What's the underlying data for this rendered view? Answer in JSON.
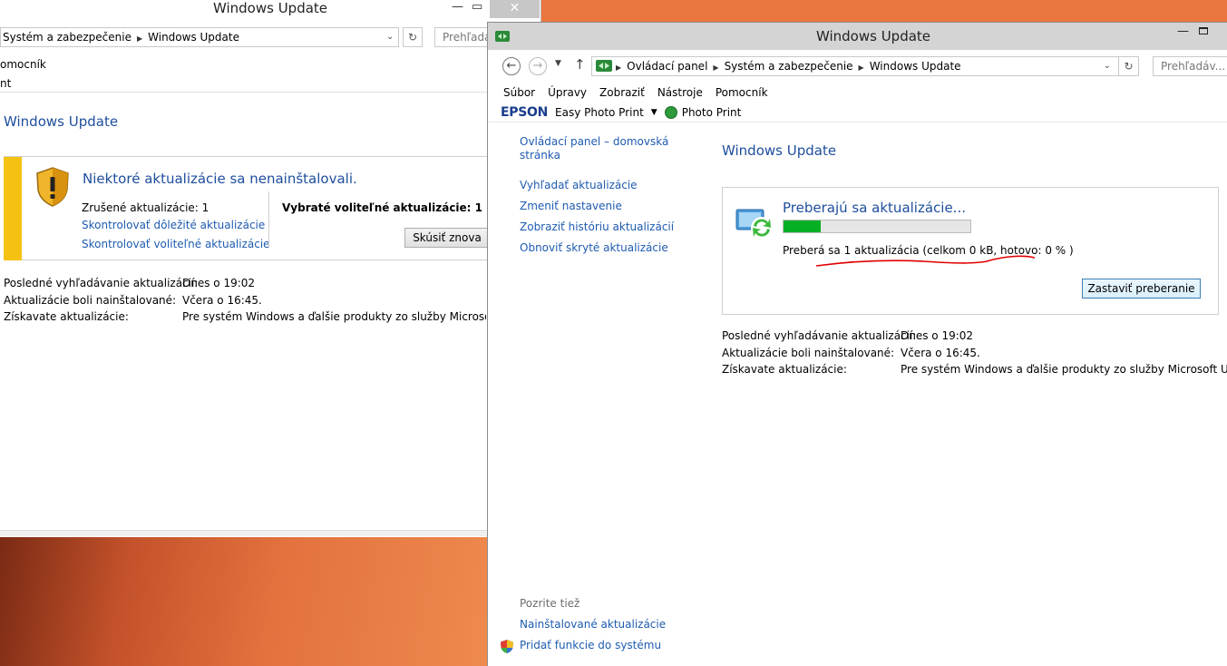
{
  "back_window": {
    "title": "Windows Update",
    "close_glyph": "✕",
    "address": {
      "crumb1": "Systém a zabezpečenie",
      "crumb2": "Windows Update"
    },
    "search_placeholder": "Prehľadá",
    "menu_line1": "omocník",
    "menu_line2": "nt",
    "heading": "Windows Update",
    "panel": {
      "title": "Niektoré aktualizácie sa nenainštalovali.",
      "cancelled": "Zrušené aktualizácie: 1",
      "link_important": "Skontrolovať dôležité aktualizácie",
      "link_optional": "Skontrolovať voliteľné aktualizácie",
      "selected_optional": "Vybraté voliteľné aktualizácie: 1",
      "retry_button": "Skúsiť znova"
    },
    "info": [
      {
        "key": "Posledné vyhľadávanie aktualizácií:",
        "value": "Dnes o 19:02"
      },
      {
        "key": "Aktualizácie boli nainštalované:",
        "value": "Včera o 16:45."
      },
      {
        "key": "Získavate aktualizácie:",
        "value": "Pre systém Windows a ďalšie produkty zo služby Microsoft Upda"
      }
    ]
  },
  "front_window": {
    "title": "Windows Update",
    "address": {
      "crumb1": "Ovládací panel",
      "crumb2": "Systém a zabezpečenie",
      "crumb3": "Windows Update"
    },
    "search_placeholder": "Prehľadáv...",
    "menu": [
      "Súbor",
      "Úpravy",
      "Zobraziť",
      "Nástroje",
      "Pomocník"
    ],
    "epson": {
      "brand": "EPSON",
      "easy_photo_print": "Easy Photo Print",
      "photo_print": "Photo Print"
    },
    "sidebar": {
      "home": "Ovládací panel – domovská",
      "home2": "stránka",
      "links": [
        "Vyhľadať aktualizácie",
        "Zmeniť nastavenie",
        "Zobraziť históriu aktualizácií",
        "Obnoviť skryté aktualizácie"
      ],
      "see_also": "Pozrite tiež",
      "see_also_links": [
        "Nainštalované aktualizácie",
        "Pridať funkcie do systému"
      ]
    },
    "heading": "Windows Update",
    "panel": {
      "title": "Preberajú sa aktualizácie...",
      "progress_fraction": 0.2,
      "status": "Preberá sa 1 aktualizácia (celkom 0 kB, hotovo: 0 % )",
      "stop_button": "Zastaviť preberanie"
    },
    "info": [
      {
        "key": "Posledné vyhľadávanie aktualizácií:",
        "value": "Dnes o 19:02"
      },
      {
        "key": "Aktualizácie boli nainštalované:",
        "value": "Včera o 16:45."
      },
      {
        "key": "Získavate aktualizácie:",
        "value": "Pre systém Windows a ďalšie produkty zo služby Microsoft Update"
      }
    ]
  },
  "colors": {
    "link": "#1e5bb0",
    "heading": "#1e4e9c",
    "progress": "#06b025",
    "warning_bar": "#f5c211",
    "annotation": "#e00000"
  }
}
